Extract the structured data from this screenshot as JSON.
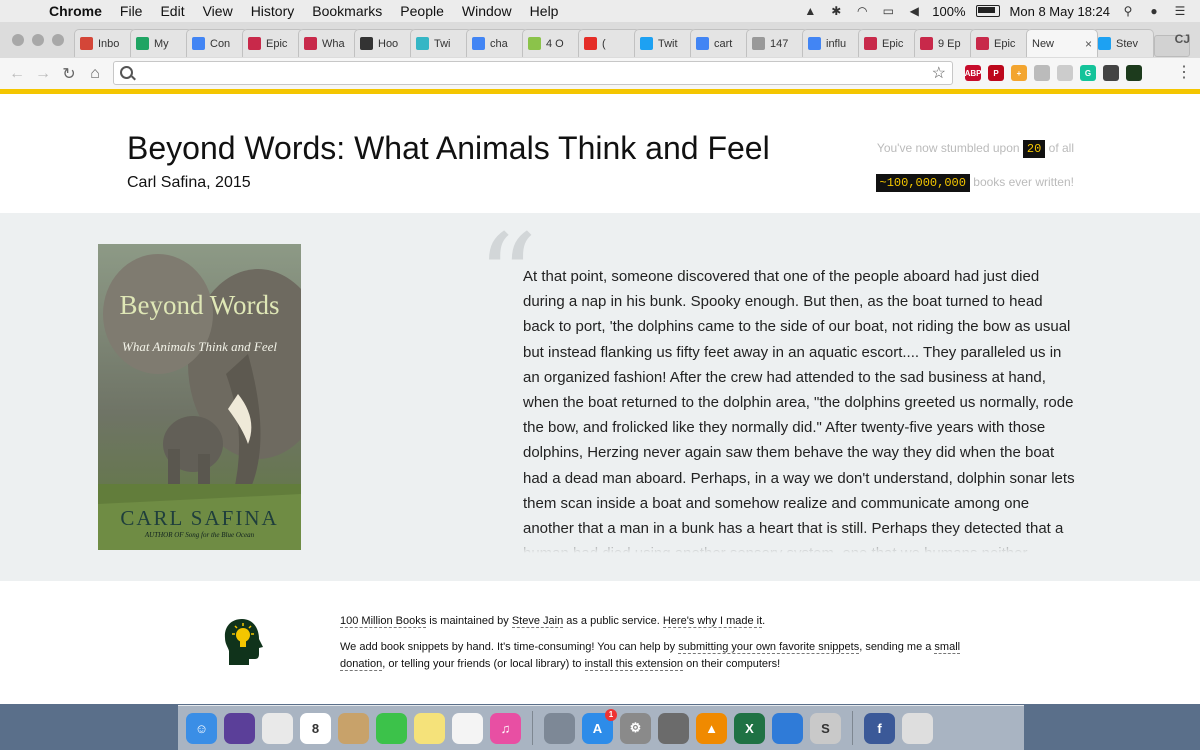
{
  "menubar": {
    "app": "Chrome",
    "items": [
      "File",
      "Edit",
      "View",
      "History",
      "Bookmarks",
      "People",
      "Window",
      "Help"
    ],
    "battery": "100%",
    "clock": "Mon 8 May  18:24"
  },
  "tabs": [
    {
      "label": "Inbo",
      "icon": "gmail-icon",
      "color": "#d44638"
    },
    {
      "label": "My",
      "icon": "google-drive-icon",
      "color": "#1fa463"
    },
    {
      "label": "Con",
      "icon": "google-docs-icon",
      "color": "#4285f4"
    },
    {
      "label": "Epic",
      "icon": "epic-icon",
      "color": "#c8294a"
    },
    {
      "label": "Wha",
      "icon": "epic-icon",
      "color": "#c8294a"
    },
    {
      "label": "Hoo",
      "icon": "shield-icon",
      "color": "#333333"
    },
    {
      "label": "Twi",
      "icon": "circle-icon",
      "color": "#35b6c5"
    },
    {
      "label": "cha",
      "icon": "google-icon",
      "color": "#4285f4"
    },
    {
      "label": "4 O",
      "icon": "seven-icon",
      "color": "#8bc34a"
    },
    {
      "label": "(",
      "icon": "youtube-icon",
      "color": "#e52d27"
    },
    {
      "label": "Twit",
      "icon": "twitter-icon",
      "color": "#1da1f2"
    },
    {
      "label": "cart",
      "icon": "google-icon",
      "color": "#4285f4"
    },
    {
      "label": "147",
      "icon": "page-icon",
      "color": "#999999"
    },
    {
      "label": "influ",
      "icon": "google-icon",
      "color": "#4285f4"
    },
    {
      "label": "Epic",
      "icon": "epic-icon",
      "color": "#c8294a"
    },
    {
      "label": "9 Ep",
      "icon": "epic-icon",
      "color": "#c8294a"
    },
    {
      "label": "Epic",
      "icon": "epic-icon",
      "color": "#c8294a"
    },
    {
      "label": "New",
      "icon": "",
      "color": "#f6f6f6",
      "active": true
    },
    {
      "label": "Stev",
      "icon": "twitter-icon",
      "color": "#1da1f2"
    }
  ],
  "profile": "CJ",
  "omnibox": {
    "value": "",
    "placeholder": ""
  },
  "extensions": [
    {
      "name": "adblock-plus-icon",
      "label": "ABP",
      "color": "#c70d2c"
    },
    {
      "name": "pinterest-icon",
      "label": "P",
      "color": "#bd081c"
    },
    {
      "name": "plus-extension-icon",
      "label": "+",
      "color": "#f3a530"
    },
    {
      "name": "cloud-icon",
      "label": "",
      "color": "#bbbbbb"
    },
    {
      "name": "tab-icon",
      "label": "",
      "color": "#cccccc"
    },
    {
      "name": "grammarly-icon",
      "label": "G",
      "color": "#15c39a"
    },
    {
      "name": "pocket-icon",
      "label": "",
      "color": "#444444"
    },
    {
      "name": "head-bulb-icon",
      "label": "",
      "color": "#1d3b1d"
    }
  ],
  "page": {
    "title": "Beyond Words: What Animals Think and Feel",
    "author_year": "Carl Safina, 2015",
    "counter": {
      "prefix": "You've now stumbled upon",
      "count": "20",
      "of_all": "of all",
      "total": "~100,000,000",
      "suffix": "books ever written!"
    },
    "cover": {
      "title": "Beyond Words",
      "subtitle": "What Animals Think and Feel",
      "author": "CARL SAFINA",
      "tagline": "AUTHOR OF Song for the Blue Ocean"
    },
    "quote": "At that point, someone discovered that one of the people aboard had just died during a nap in his bunk. Spooky enough. But then, as the boat turned to head back to port, 'the dolphins came to the side of our boat, not riding the bow as usual but instead flanking us fifty feet away in an aquatic escort.... They paralleled us in an organized fashion! After the crew had attended to the sad business at hand, when the boat returned to the dolphin area, \"the dolphins greeted us normally, rode the bow, and frolicked like they normally did.\" After twenty-five years with those dolphins, Herzing never again saw them behave the way they did when the boat had a dead man aboard. Perhaps, in a way we don't understand, dolphin sonar lets them scan inside a boat and somehow realize and communicate among one another that a man in a bunk has a heart that is still. Perhaps they detected that a human had died using another sensory system, one that we humans neither possess nor suspect. And what does it mean for",
    "footer": {
      "site_link": "100 Million Books",
      "maintained_text": " is maintained by ",
      "author_link": "Steve Jain",
      "service_text": " as a public service. ",
      "why_link": "Here's why I made it",
      "period": ".",
      "p2_a": "We add book snippets by hand. It's time-consuming! You can help by ",
      "submit_link": "submitting your own favorite snippets",
      "p2_b": ", sending me a ",
      "donation_link": "small donation",
      "p2_c": ", or telling your friends (or local library) to ",
      "install_link": "install this extension",
      "p2_d": " on their computers!"
    }
  },
  "dock": [
    {
      "name": "finder-icon",
      "label": "☺",
      "color": "#3a8ee6"
    },
    {
      "name": "siri-icon",
      "label": "",
      "color": "#5b3f99"
    },
    {
      "name": "chrome-icon",
      "label": "",
      "color": "#e9e9e9"
    },
    {
      "name": "calendar-icon",
      "label": "8",
      "color": "#ffffff"
    },
    {
      "name": "contacts-icon",
      "label": "",
      "color": "#c8a26a"
    },
    {
      "name": "facetime-icon",
      "label": "",
      "color": "#3cc24a"
    },
    {
      "name": "notes-icon",
      "label": "",
      "color": "#f5e27a"
    },
    {
      "name": "reminders-icon",
      "label": "",
      "color": "#f4f4f4"
    },
    {
      "name": "itunes-icon",
      "label": "♫",
      "color": "#e84fa3"
    },
    {
      "name": "launchpad-icon",
      "label": "",
      "color": "#7d8896"
    },
    {
      "name": "app-store-icon",
      "label": "A",
      "color": "#2d8ce9",
      "badge": "1"
    },
    {
      "name": "system-preferences-icon",
      "label": "⚙",
      "color": "#8a8a8a"
    },
    {
      "name": "calculator-icon",
      "label": "",
      "color": "#6b6b6b"
    },
    {
      "name": "vlc-icon",
      "label": "▲",
      "color": "#f08a00"
    },
    {
      "name": "excel-icon",
      "label": "X",
      "color": "#1f7244"
    },
    {
      "name": "keynote-icon",
      "label": "",
      "color": "#2f7bd8"
    },
    {
      "name": "scrivener-icon",
      "label": "S",
      "color": "#c9c9c9"
    },
    {
      "name": "facebook-icon",
      "label": "f",
      "color": "#3b5998"
    },
    {
      "name": "trash-icon",
      "label": "",
      "color": "#dedede"
    }
  ]
}
